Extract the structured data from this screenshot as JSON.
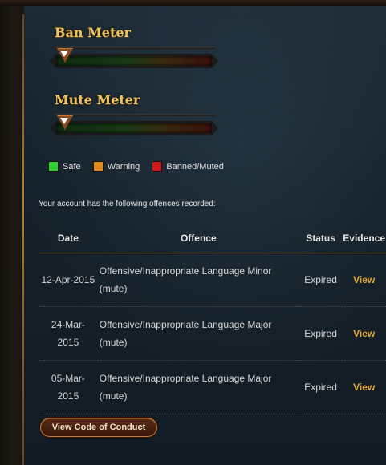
{
  "ban_meter": {
    "title": "Ban Meter",
    "level_fraction": 0.0
  },
  "mute_meter": {
    "title": "Mute Meter",
    "level_fraction": 0.0
  },
  "legend": [
    {
      "label": "Safe",
      "color": "#2fcf2f"
    },
    {
      "label": "Warning",
      "color": "#e08a1e"
    },
    {
      "label": "Banned/Muted",
      "color": "#d11a1a"
    }
  ],
  "intro_text": "Your account has the following offences recorded:",
  "table": {
    "headers": {
      "date": "Date",
      "offence": "Offence",
      "status": "Status",
      "evidence": "Evidence"
    },
    "rows": [
      {
        "date_line1": "12-Apr-2015",
        "date_line2": "",
        "offence_line1": "Offensive/Inappropriate Language Minor",
        "offence_line2": "(mute)",
        "status": "Expired",
        "evidence": "View"
      },
      {
        "date_line1": "24-Mar-",
        "date_line2": "2015",
        "offence_line1": "Offensive/Inappropriate Language Major",
        "offence_line2": "(mute)",
        "status": "Expired",
        "evidence": "View"
      },
      {
        "date_line1": "05-Mar-",
        "date_line2": "2015",
        "offence_line1": "Offensive/Inappropriate Language Major",
        "offence_line2": "(mute)",
        "status": "Expired",
        "evidence": "View"
      }
    ]
  },
  "code_of_conduct_button": "View Code of Conduct"
}
